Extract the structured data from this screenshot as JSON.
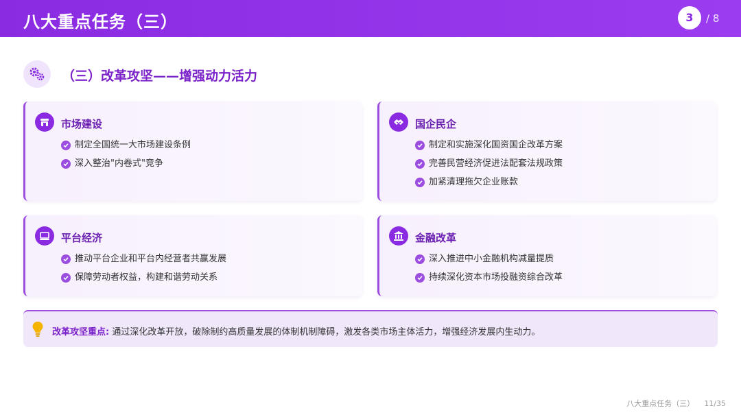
{
  "header": {
    "title": "八大重点任务（三）",
    "current_page": "3",
    "total_pages": "/ 8"
  },
  "section": {
    "title": "（三）改革攻坚——增强动力活力",
    "icon": "gears-icon"
  },
  "cards": [
    {
      "title": "市场建设",
      "icon": "store-icon",
      "items": [
        "制定全国统一大市场建设条例",
        "深入整治\"内卷式\"竞争"
      ]
    },
    {
      "title": "国企民企",
      "icon": "handshake-icon",
      "items": [
        "制定和实施深化国资国企改革方案",
        "完善民营经济促进法配套法规政策",
        "加紧清理拖欠企业账款"
      ]
    },
    {
      "title": "平台经济",
      "icon": "laptop-icon",
      "items": [
        "推动平台企业和平台内经营者共赢发展",
        "保障劳动者权益，构建和谐劳动关系"
      ]
    },
    {
      "title": "金融改革",
      "icon": "bank-icon",
      "items": [
        "深入推进中小金融机构减量提质",
        "持续深化资本市场投融资综合改革"
      ]
    }
  ],
  "note": {
    "icon": "lightbulb-icon",
    "label": "改革攻坚重点:",
    "text": " 通过深化改革开放，破除制约高质量发展的体制机制障碍，激发各类市场主体活力，增强经济发展内生动力。"
  },
  "footer": {
    "title": "八大重点任务（三）",
    "page": "11/35"
  },
  "colors": {
    "accent": "#8a2be2",
    "title": "#7b22c9",
    "card_bg": "#f7f0fd"
  }
}
